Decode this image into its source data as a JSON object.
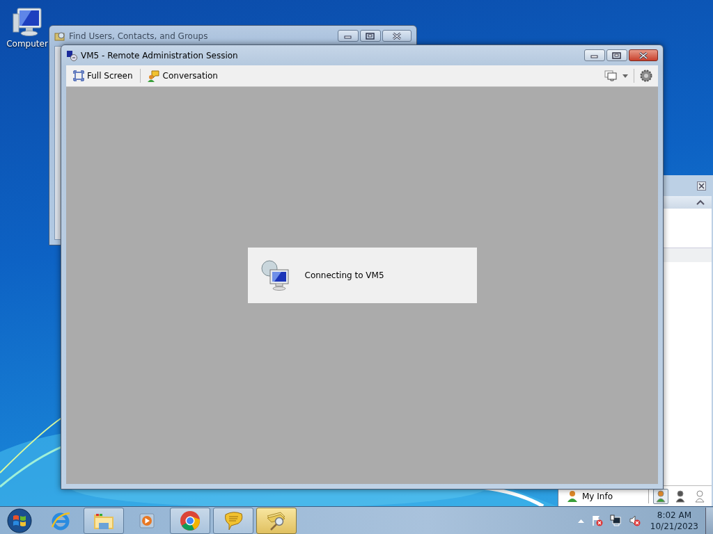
{
  "desktop_icons": [
    {
      "label": "Computer"
    }
  ],
  "find_window": {
    "title": "Find Users, Contacts, and Groups"
  },
  "messenger_window": {
    "my_info": "My Info",
    "status_buttons": [
      {
        "selected": true
      },
      {
        "selected": false
      },
      {
        "selected": false
      }
    ]
  },
  "session_window": {
    "title": "VM5 - Remote Administration Session",
    "toolbar": [
      {
        "kind": "fullscreen",
        "label": "Full Screen"
      },
      {
        "kind": "conversation",
        "label": "Conversation"
      }
    ],
    "status_message": "Connecting to VM5"
  },
  "taskbar": {
    "items": [
      {
        "kind": "browser",
        "running": false,
        "selected": false
      },
      {
        "kind": "folder",
        "running": true,
        "selected": false
      },
      {
        "kind": "media",
        "running": false,
        "selected": false
      },
      {
        "kind": "chrome",
        "running": true,
        "selected": false
      },
      {
        "kind": "chat",
        "running": true,
        "selected": false
      },
      {
        "kind": "find",
        "running": true,
        "selected": true
      }
    ],
    "clock": {
      "time": "8:02 AM",
      "date": "10/21/2023"
    }
  }
}
